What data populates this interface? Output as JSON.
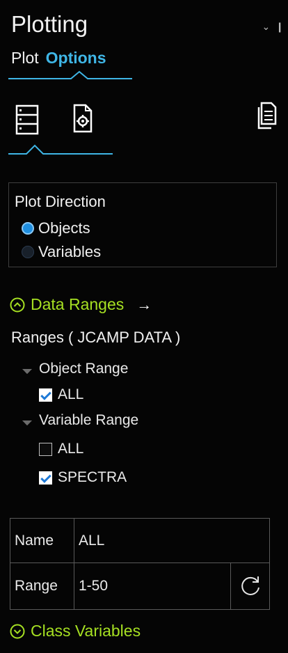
{
  "header": {
    "title": "Plotting",
    "pin_glyph": "⌄",
    "pin2_glyph": "❙"
  },
  "tabs": [
    {
      "label": "Plot",
      "active": false
    },
    {
      "label": "Options",
      "active": true
    }
  ],
  "toolbar": {
    "items": [
      {
        "icon": "list-view-icon",
        "selected": true
      },
      {
        "icon": "document-settings-icon",
        "selected": false
      },
      {
        "icon": "copy-document-icon",
        "selected": false
      }
    ]
  },
  "plot_direction": {
    "title": "Plot Direction",
    "options": [
      {
        "label": "Objects",
        "selected": true
      },
      {
        "label": "Variables",
        "selected": false
      }
    ]
  },
  "data_ranges": {
    "title": "Data Ranges",
    "arrow": "→",
    "ranges_label": "Ranges ( JCAMP DATA )",
    "object_range": {
      "label": "Object Range",
      "items": [
        {
          "label": "ALL",
          "checked": true
        }
      ]
    },
    "variable_range": {
      "label": "Variable Range",
      "items": [
        {
          "label": "ALL",
          "checked": false
        },
        {
          "label": "SPECTRA",
          "checked": true
        }
      ]
    }
  },
  "range_grid": {
    "name_label": "Name",
    "name_value": "ALL",
    "range_label": "Range",
    "range_value": "1-50"
  },
  "class_variables": {
    "title": "Class Variables"
  },
  "colors": {
    "accent_blue": "#3fb6e6",
    "section_green": "#a6e022",
    "background": "#050505"
  }
}
